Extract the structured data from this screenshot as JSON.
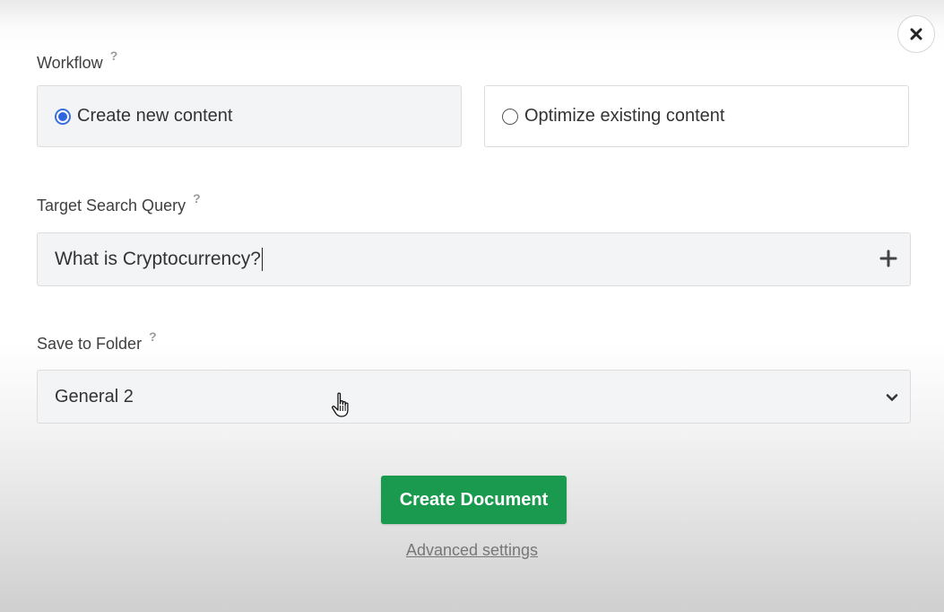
{
  "workflow": {
    "label": "Workflow",
    "help": "?",
    "options": [
      {
        "label": "Create new content",
        "selected": true
      },
      {
        "label": "Optimize existing content",
        "selected": false
      }
    ]
  },
  "query": {
    "label": "Target Search Query",
    "help": "?",
    "value": "What is Cryptocurrency?",
    "add_icon": "plus-icon"
  },
  "folder": {
    "label": "Save to Folder",
    "help": "?",
    "selected": "General 2",
    "dropdown_icon": "chevron-down-icon"
  },
  "actions": {
    "create_label": "Create Document",
    "advanced_label": "Advanced settings"
  },
  "icons": {
    "close": "close-icon",
    "cursor": "hand-pointer-icon"
  },
  "colors": {
    "primary": "#1a9a4f",
    "radio_accent": "#2f66e0",
    "field_bg": "#f2f4f6"
  }
}
